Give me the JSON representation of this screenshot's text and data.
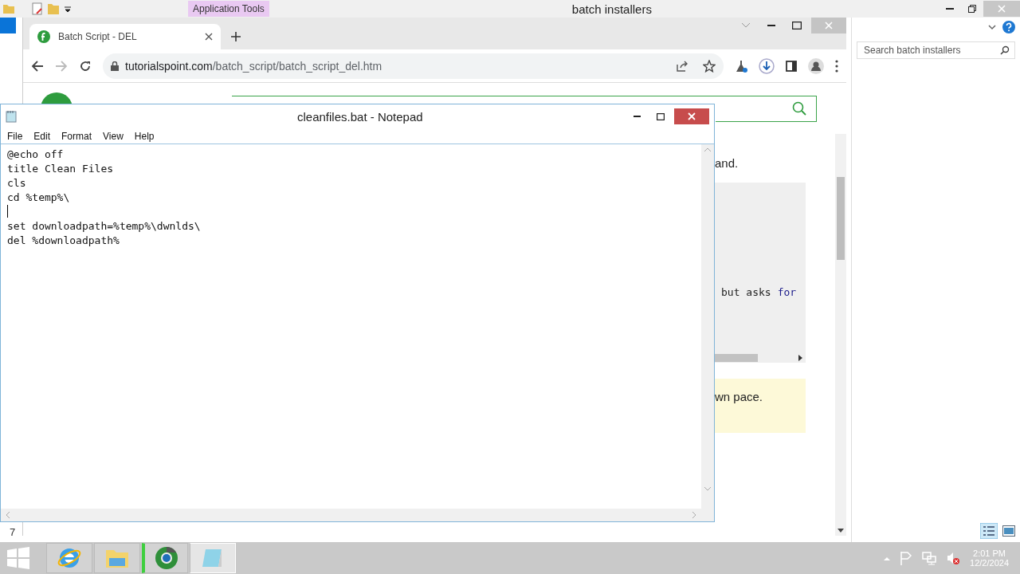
{
  "explorer": {
    "title": "batch installers",
    "ribbon_tab": "Application Tools",
    "search": {
      "placeholder": "Search batch installers"
    },
    "row_number": "7"
  },
  "browser": {
    "tab": {
      "title": "Batch Script - DEL",
      "selected": true
    },
    "url": {
      "domain": "tutorialspoint.com",
      "path": "/batch_script/batch_script_del.htm"
    },
    "text_fragment": "and.",
    "code_words": [
      {
        "text": "but asks",
        "kind": "plain"
      },
      {
        "text": "for",
        "kind": "keyword"
      }
    ],
    "note_fragment": "wn pace."
  },
  "notepad": {
    "title": "cleanfiles.bat - Notepad",
    "menu": [
      "File",
      "Edit",
      "Format",
      "View",
      "Help"
    ],
    "lines": [
      {
        "kind": "text",
        "text": "@echo off"
      },
      {
        "kind": "text",
        "text": "title Clean Files"
      },
      {
        "kind": "text",
        "text": "cls"
      },
      {
        "kind": "text",
        "text": "cd %temp%\\"
      },
      {
        "kind": "caret"
      },
      {
        "kind": "text",
        "text": "set downloadpath=%temp%\\dwnlds\\"
      },
      {
        "kind": "text",
        "text": "del %downloadpath%"
      }
    ]
  },
  "taskbar": {
    "apps": [
      {
        "kind": "ie",
        "selected": false
      },
      {
        "kind": "explorer",
        "selected": false
      },
      {
        "kind": "chrome",
        "selected": false
      },
      {
        "kind": "notepad",
        "selected": true
      }
    ],
    "time": "2:01 PM",
    "date": "12/2/2024"
  }
}
